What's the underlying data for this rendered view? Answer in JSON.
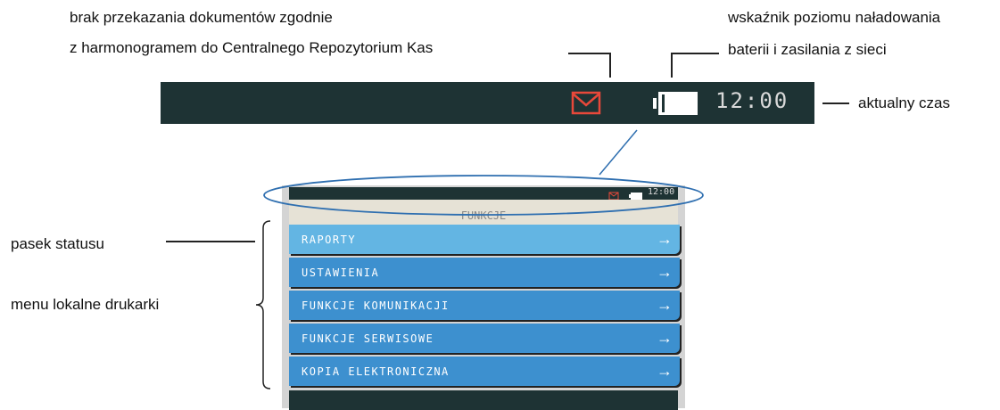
{
  "annotations": {
    "no_transfer_line1": "brak przekazania dokumentów zgodnie",
    "no_transfer_line2": "z harmonogramem do Centralnego Repozytorium Kas",
    "battery_line1": "wskaźnik poziomu naładowania",
    "battery_line2": "baterii i zasilania z sieci",
    "current_time": "aktualny  czas",
    "status_bar": "pasek statusu",
    "local_menu": "menu lokalne drukarki"
  },
  "status_bar": {
    "time": "12:00",
    "mail_icon": "envelope-icon",
    "battery_icon": "battery-icon",
    "mail_color": "#e8483a",
    "background": "#1e3334"
  },
  "device": {
    "status_time": "12:00",
    "header": "FUNKCJE",
    "menu_items": [
      {
        "label": "RAPORTY",
        "arrow": "→"
      },
      {
        "label": "USTAWIENIA",
        "arrow": "→"
      },
      {
        "label": "FUNKCJE KOMUNIKACJI",
        "arrow": "→"
      },
      {
        "label": "FUNKCJE SERWISOWE",
        "arrow": "→"
      },
      {
        "label": "KOPIA ELEKTRONICZNA",
        "arrow": "→"
      }
    ],
    "menu_color": "#3d90cf",
    "menu_selected_color": "#63b5e3"
  }
}
